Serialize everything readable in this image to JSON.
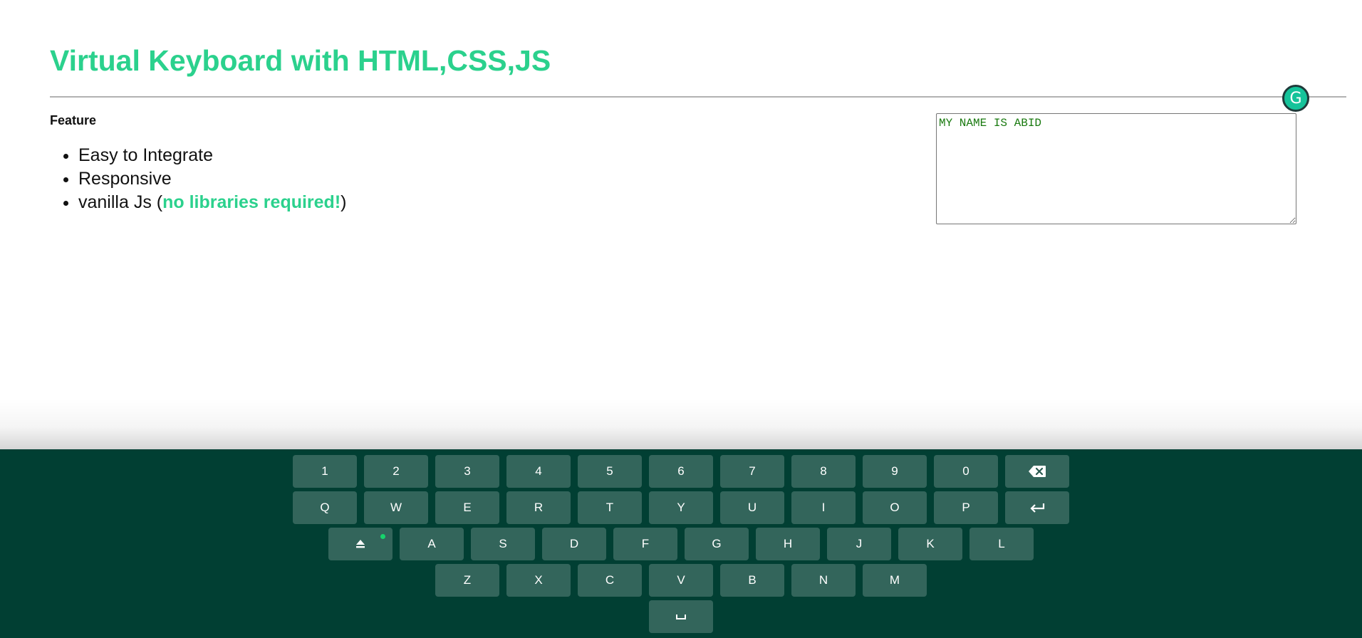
{
  "page": {
    "title": "Virtual Keyboard with HTML,CSS,JS"
  },
  "features": {
    "heading": "Feature",
    "items": [
      "Easy to Integrate",
      "Responsive"
    ],
    "item3_prefix": "vanilla Js (",
    "item3_highlight": "no libraries required!",
    "item3_suffix": ")"
  },
  "textarea": {
    "value": "MY NAME IS ABID"
  },
  "grammarly": {
    "icon": "grammarly-g-icon",
    "glyph": "G"
  },
  "keyboard": {
    "row1": [
      "1",
      "2",
      "3",
      "4",
      "5",
      "6",
      "7",
      "8",
      "9",
      "0"
    ],
    "row2": [
      "Q",
      "W",
      "E",
      "R",
      "T",
      "Y",
      "U",
      "I",
      "O",
      "P"
    ],
    "row3": [
      "A",
      "S",
      "D",
      "F",
      "G",
      "H",
      "J",
      "K",
      "L"
    ],
    "row4": [
      "Z",
      "X",
      "C",
      "V",
      "B",
      "N",
      "M"
    ],
    "backspace_icon": "backspace-icon",
    "enter_icon": "enter-icon",
    "caps_icon": "caps-lock-icon",
    "space_icon": "space-icon",
    "caps_active": true
  },
  "colors": {
    "accent": "#2bd18d",
    "keyboard_bg": "#013f33",
    "caps_indicator": "#16d46c",
    "text_input": "#1a7a10"
  }
}
